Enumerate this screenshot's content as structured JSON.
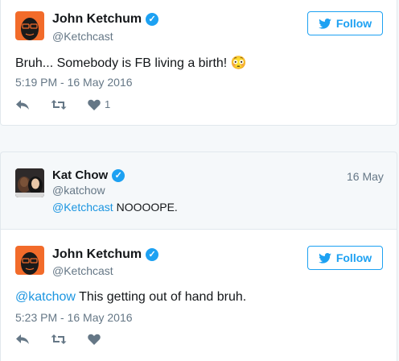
{
  "tweets": [
    {
      "name": "John Ketchum",
      "handle": "@Ketchcast",
      "follow_label": "Follow",
      "text": "Bruh... Somebody is FB living a birth! ",
      "emoji": "😳",
      "time": "5:19 PM - 16 May 2016",
      "likes": "1"
    },
    {
      "name": "Kat Chow",
      "handle": "@katchow",
      "date": "16 May",
      "mention": "@Ketchcast",
      "text": " NOOOOPE."
    },
    {
      "name": "John Ketchum",
      "handle": "@Ketchcast",
      "follow_label": "Follow",
      "mention": "@katchow",
      "text": " This getting out of hand bruh.",
      "time": "5:23 PM - 16 May 2016"
    }
  ],
  "colors": {
    "accent": "#1da1f2",
    "avatar_orange": "#f26b2a",
    "muted": "#657786"
  },
  "icons": [
    "verified-icon",
    "twitter-bird-icon",
    "reply-icon",
    "retweet-icon",
    "heart-icon"
  ]
}
